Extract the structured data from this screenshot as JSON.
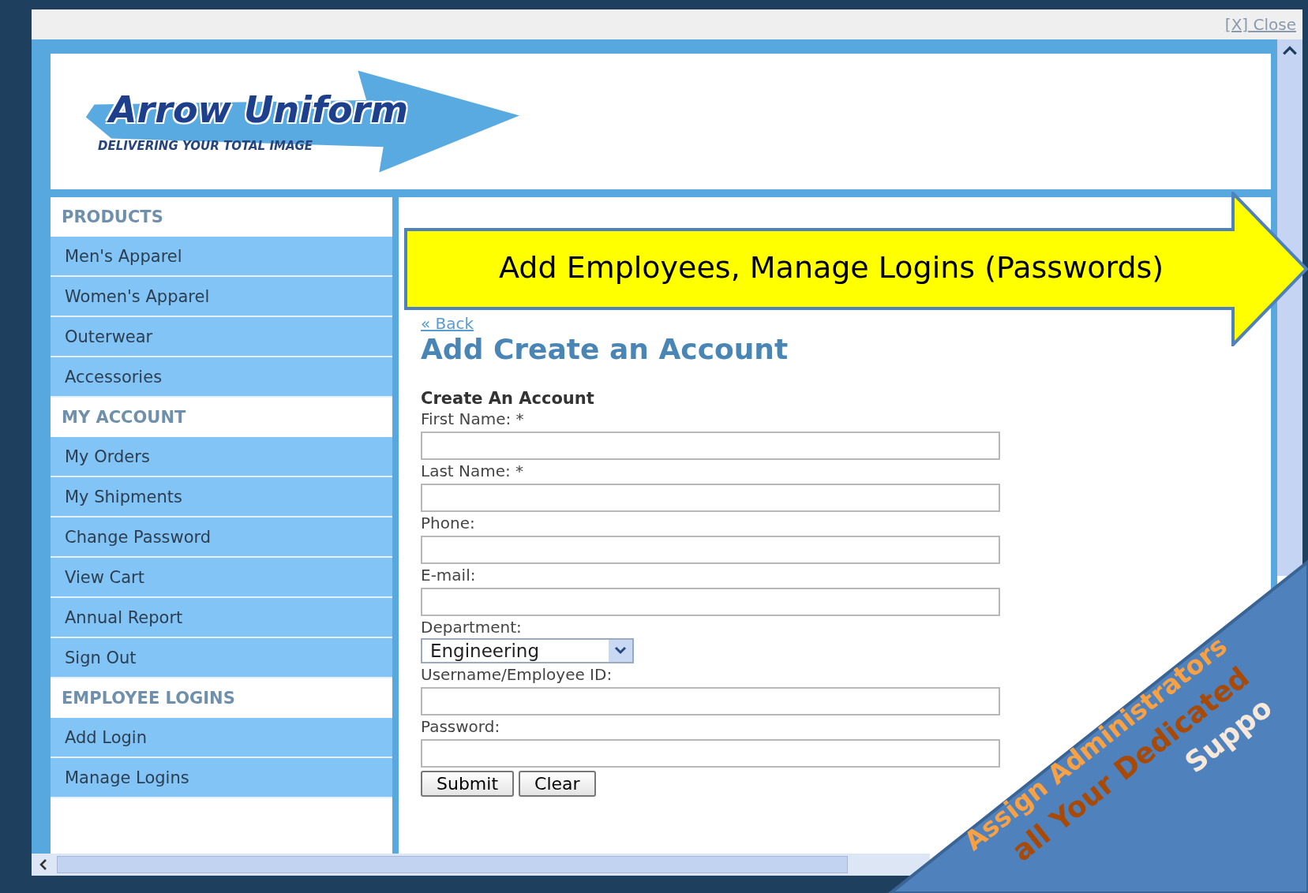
{
  "window": {
    "close_link": "[X] Close"
  },
  "logo": {
    "name": "Arrow Uniform",
    "tagline": "DELIVERING YOUR TOTAL IMAGE"
  },
  "sidebar": {
    "sections": [
      {
        "heading": "PRODUCTS",
        "items": [
          "Men's Apparel",
          "Women's Apparel",
          "Outerwear",
          "Accessories"
        ]
      },
      {
        "heading": "MY ACCOUNT",
        "items": [
          "My Orders",
          "My Shipments",
          "Change Password",
          "View Cart",
          "Annual Report",
          "Sign Out"
        ]
      },
      {
        "heading": "EMPLOYEE LOGINS",
        "items": [
          "Add Login",
          "Manage Logins"
        ]
      }
    ]
  },
  "content": {
    "back_link": "« Back",
    "title": "Add Create an Account",
    "form": {
      "heading": "Create An Account",
      "fields": [
        {
          "kind": "text",
          "label": "First Name: *"
        },
        {
          "kind": "text",
          "label": "Last Name: *"
        },
        {
          "kind": "text",
          "label": "Phone:"
        },
        {
          "kind": "text",
          "label": "E-mail:"
        },
        {
          "kind": "select",
          "label": "Department:",
          "value": "Engineering"
        },
        {
          "kind": "text",
          "label": "Username/Employee ID:"
        },
        {
          "kind": "text",
          "label": "Password:"
        }
      ],
      "buttons": [
        "Submit",
        "Clear"
      ]
    }
  },
  "callout": {
    "text": "Add Employees, Manage Logins (Passwords)"
  },
  "banner": {
    "lines": [
      "Assign Administrators",
      "all Your Dedicated",
      "Suppo"
    ]
  }
}
